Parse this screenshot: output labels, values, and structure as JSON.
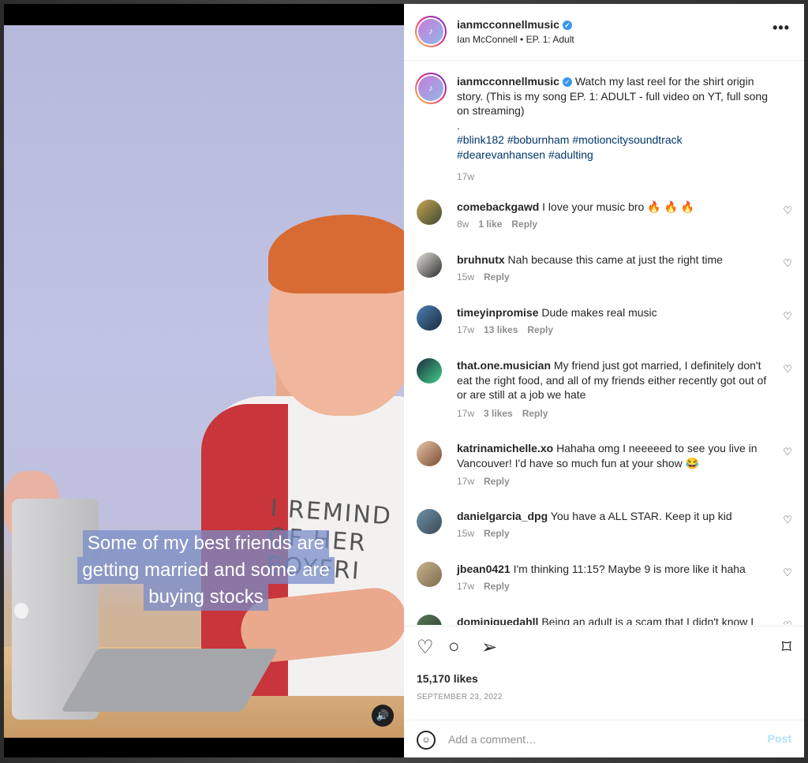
{
  "post": {
    "username": "ianmcconnellmusic",
    "subtitle": "Ian McConnell • EP. 1: Adult",
    "caption": {
      "text": "Watch my last reel for the shirt origin story. (This is my song EP. 1: ADULT - full video on YT, full song on streaming)",
      "dot": ".",
      "tags_line1": "#blink182 #boburnham #motioncitysoundtrack",
      "tags_line2": "#dearevanhansen #adulting",
      "time": "17w"
    },
    "video": {
      "subtitle_lines": [
        "Some of my best friends are",
        "getting married and some are",
        "buying stocks"
      ],
      "shirt_text": "I REMIND\nOF HER\nBOYFRI"
    },
    "comments": [
      {
        "user": "comebackgawd",
        "text": "I love your music bro 🔥 🔥 🔥",
        "time": "8w",
        "likes": "1 like",
        "reply": "Reply"
      },
      {
        "user": "bruhnutx",
        "text": "Nah because this came at just the right time",
        "time": "15w",
        "likes": "",
        "reply": "Reply"
      },
      {
        "user": "timeyinpromise",
        "text": "Dude makes real music",
        "time": "17w",
        "likes": "13 likes",
        "reply": "Reply"
      },
      {
        "user": "that.one.musician",
        "text": "My friend just got married, I definitely don't eat the right food, and all of my friends either recently got out of or are still at a job we hate",
        "time": "17w",
        "likes": "3 likes",
        "reply": "Reply"
      },
      {
        "user": "katrinamichelle.xo",
        "text": "Hahaha omg I neeeeed to see you live in Vancouver! I'd have so much fun at your show 😂",
        "time": "17w",
        "likes": "",
        "reply": "Reply"
      },
      {
        "user": "danielgarcia_dpg",
        "text": "You have a ALL STAR. Keep it up kid",
        "time": "15w",
        "likes": "",
        "reply": "Reply"
      },
      {
        "user": "jbean0421",
        "text": "I'm thinking 11:15? Maybe 9 is more like it haha",
        "time": "17w",
        "likes": "",
        "reply": "Reply"
      },
      {
        "user": "dominiquedahll",
        "text": "Being an adult is a scam that I didn't know I",
        "time": "",
        "likes": "",
        "reply": ""
      }
    ],
    "likes": "15,170 likes",
    "date": "SEPTEMBER 23, 2022",
    "add_comment_placeholder": "Add a comment…",
    "post_label": "Post"
  },
  "colors": {
    "link": "#00376b",
    "muted": "#8e8e8e",
    "verified": "#3897f0",
    "post_button": "#b2dffc"
  }
}
